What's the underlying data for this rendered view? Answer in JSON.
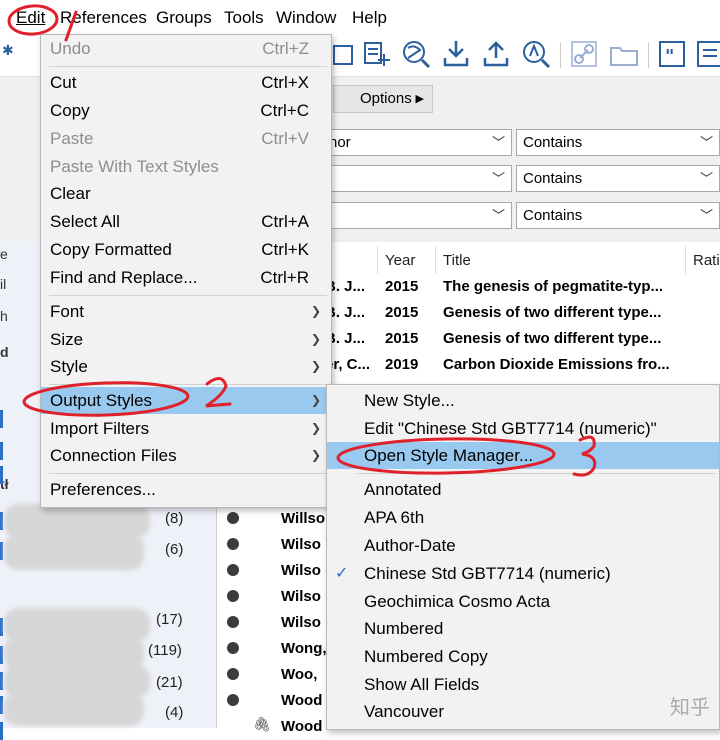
{
  "menubar": {
    "items": [
      "Edit",
      "References",
      "Groups",
      "Tools",
      "Window",
      "Help"
    ]
  },
  "search": {
    "options_label": "Options",
    "fields": [
      "hor",
      "",
      ""
    ],
    "operators": [
      "Contains",
      "Contains",
      "Contains"
    ]
  },
  "reflist": {
    "columns": {
      "year": "Year",
      "title": "Title",
      "rating": "Rati"
    },
    "rows": [
      {
        "author": "B. J...",
        "year": "2015",
        "title": "The genesis of pegmatite-typ..."
      },
      {
        "author": "B. J...",
        "year": "2015",
        "title": "Genesis of two different type..."
      },
      {
        "author": "B. J...",
        "year": "2015",
        "title": "Genesis of two different type..."
      },
      {
        "author": "er, C...",
        "year": "2019",
        "title": "Carbon Dioxide Emissions fro..."
      }
    ],
    "lower_authors": [
      "Willso",
      "Wilso",
      "Wilso",
      "Wilso",
      "Wilso",
      "Wong,",
      "Woo,",
      "Wood",
      "Wood"
    ]
  },
  "leftpanel": {
    "counts": [
      "(8)",
      "(6)",
      "(17)",
      "(119)",
      "(21)",
      "(4)"
    ]
  },
  "edit_menu": {
    "items": [
      {
        "label": "Undo",
        "shortcut": "Ctrl+Z",
        "disabled": true
      },
      {
        "label": "Cut",
        "shortcut": "Ctrl+X"
      },
      {
        "label": "Copy",
        "shortcut": "Ctrl+C"
      },
      {
        "label": "Paste",
        "shortcut": "Ctrl+V",
        "disabled": true
      },
      {
        "label": "Paste With Text Styles",
        "shortcut": "",
        "disabled": true
      },
      {
        "label": "Clear",
        "shortcut": ""
      },
      {
        "label": "Select All",
        "shortcut": "Ctrl+A"
      },
      {
        "label": "Copy Formatted",
        "shortcut": "Ctrl+K"
      },
      {
        "label": "Find and Replace...",
        "shortcut": "Ctrl+R"
      },
      {
        "label": "Font",
        "submenu": true
      },
      {
        "label": "Size",
        "submenu": true
      },
      {
        "label": "Style",
        "submenu": true
      },
      {
        "label": "Output Styles",
        "submenu": true,
        "highlighted": true
      },
      {
        "label": "Import Filters",
        "submenu": true
      },
      {
        "label": "Connection Files",
        "submenu": true
      },
      {
        "label": "Preferences..."
      }
    ]
  },
  "styles_menu": {
    "items": [
      {
        "label": "New Style..."
      },
      {
        "label": "Edit \"Chinese Std GBT7714 (numeric)\""
      },
      {
        "label": "Open Style Manager...",
        "highlighted": true
      },
      {
        "label": "Annotated"
      },
      {
        "label": "APA 6th"
      },
      {
        "label": "Author-Date"
      },
      {
        "label": "Chinese Std GBT7714 (numeric)",
        "checked": true
      },
      {
        "label": "Geochimica Cosmo Acta"
      },
      {
        "label": "Numbered"
      },
      {
        "label": "Numbered Copy"
      },
      {
        "label": "Show All Fields"
      },
      {
        "label": "Vancouver"
      }
    ]
  },
  "annotations": {
    "marks": [
      "1",
      "2",
      "3"
    ]
  },
  "watermark": "知乎",
  "colors": {
    "highlight": "#99c9ef",
    "annotation": "#e0202a",
    "menu_bg": "#f2f2f2"
  }
}
